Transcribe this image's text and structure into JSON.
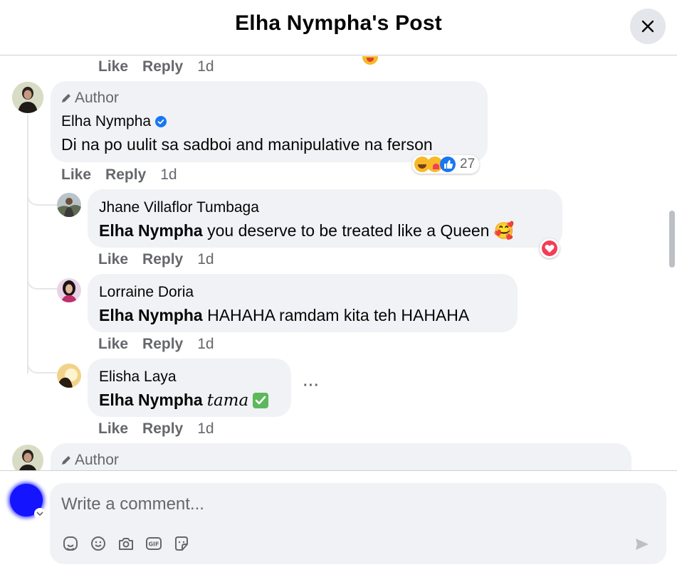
{
  "header": {
    "title": "Elha Nympha's Post"
  },
  "top_actions": {
    "like": "Like",
    "reply": "Reply",
    "time": "1d"
  },
  "comments": [
    {
      "author_tag": "Author",
      "name": "Elha Nympha",
      "verified": true,
      "text": "Di na po uulit sa sadboi and manipulative na ferson",
      "reactions_count": "27",
      "like": "Like",
      "reply": "Reply",
      "time": "1d"
    }
  ],
  "replies": [
    {
      "name": "Jhane Villaflor Tumbaga",
      "mention": "Elha Nympha",
      "text": "you deserve to be treated like a Queen",
      "emoji": "🥰",
      "like": "Like",
      "reply": "Reply",
      "time": "1d"
    },
    {
      "name": "Lorraine Doria",
      "mention": "Elha Nympha",
      "text": "HAHAHA ramdam kita teh HAHAHA",
      "like": "Like",
      "reply": "Reply",
      "time": "1d"
    },
    {
      "name": "Elisha Laya",
      "mention": "Elha Nympha",
      "text": "𝑡𝑎𝑚𝑎",
      "emoji": "✅",
      "like": "Like",
      "reply": "Reply",
      "time": "1d"
    }
  ],
  "next_comment": {
    "author_tag": "Author"
  },
  "composer": {
    "placeholder": "Write a comment..."
  },
  "icons": {
    "close": "close-icon",
    "pencil": "pencil-icon",
    "verified": "verified-badge-icon",
    "sticker_avatar": "avatar-sticker-icon",
    "emoji": "emoji-icon",
    "camera": "camera-icon",
    "gif": "gif-icon",
    "sticker": "sticker-icon",
    "send": "send-icon"
  },
  "colors": {
    "accent": "#1877f2",
    "bubble": "#f0f2f5",
    "muted": "#65676b",
    "heart": "#f33e58"
  }
}
